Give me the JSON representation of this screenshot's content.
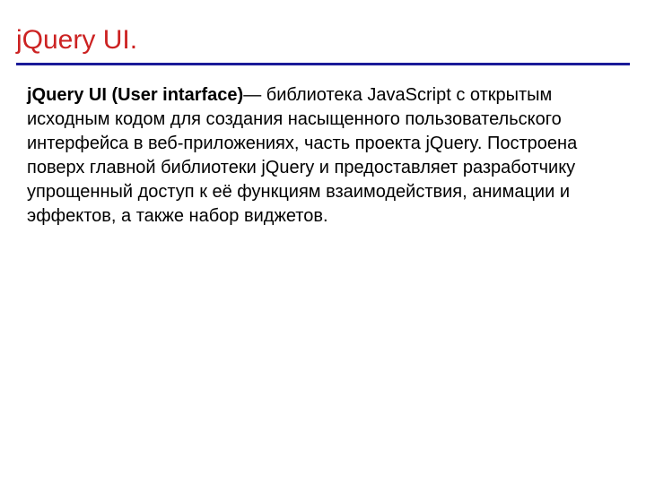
{
  "title": "jQuery UI.",
  "body": {
    "lead": "jQuery UI (User intarface)",
    "text": "— библиотека JavaScript с открытым исходным кодом для создания насыщенного пользовательского интерфейса в веб-приложениях, часть проекта jQuery. Построена поверх главной библиотеки jQuery и предоставляет разработчику упрощенный доступ к её функциям взаимодействия, анимации и эффектов, а также набор виджетов."
  }
}
